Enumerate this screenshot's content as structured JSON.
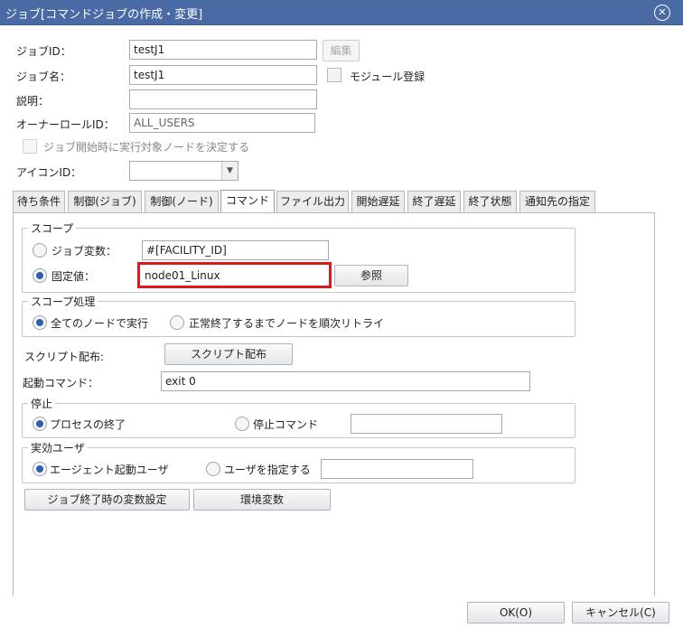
{
  "window": {
    "title": "ジョブ[コマンドジョブの作成・変更]",
    "close_icon": "close-circle-icon"
  },
  "form": {
    "job_id_label": "ジョブID：",
    "job_id_value": "testJ1",
    "edit_button": "編集",
    "job_name_label": "ジョブ名：",
    "job_name_value": "testJ1",
    "module_label": "モジュール登録",
    "description_label": "説明：",
    "description_value": "",
    "owner_role_label": "オーナーロールID：",
    "owner_role_value": "ALL_USERS",
    "decide_node_label": "ジョブ開始時に実行対象ノードを決定する",
    "icon_id_label": "アイコンID：",
    "icon_id_value": ""
  },
  "tabs": [
    {
      "label": "待ち条件"
    },
    {
      "label": "制御(ジョブ)"
    },
    {
      "label": "制御(ノード)"
    },
    {
      "label": "コマンド"
    },
    {
      "label": "ファイル出力"
    },
    {
      "label": "開始遅延"
    },
    {
      "label": "終了遅延"
    },
    {
      "label": "終了状態"
    },
    {
      "label": "通知先の指定"
    }
  ],
  "scope": {
    "title": "スコープ",
    "job_var_label": "ジョブ変数：",
    "job_var_value": "#[FACILITY_ID]",
    "fixed_label": "固定値：",
    "fixed_value": "node01_Linux",
    "browse_button": "参照",
    "highlight_color": "#e0161b"
  },
  "scope_process": {
    "title": "スコープ処理",
    "all_nodes_label": "全てのノードで実行",
    "retry_label": "正常終了するまでノードを順次リトライ"
  },
  "script": {
    "label": "スクリプト配布:",
    "button": "スクリプト配布"
  },
  "command": {
    "label": "起動コマンド：",
    "value": "exit 0"
  },
  "stop": {
    "title": "停止",
    "process_end_label": "プロセスの終了",
    "stop_command_label": "停止コマンド",
    "stop_command_value": ""
  },
  "effective_user": {
    "title": "実効ユーザ",
    "agent_user_label": "エージェント起動ユーザ",
    "specify_user_label": "ユーザを指定する",
    "user_value": ""
  },
  "bottom_buttons": {
    "var_setting": "ジョブ終了時の変数設定",
    "env_var": "環境変数"
  },
  "footer": {
    "ok": "OK(O)",
    "cancel": "キャンセル(C)"
  },
  "colors": {
    "titlebar": "#4a6aa5",
    "radio_selected": "#2f5fb0"
  }
}
